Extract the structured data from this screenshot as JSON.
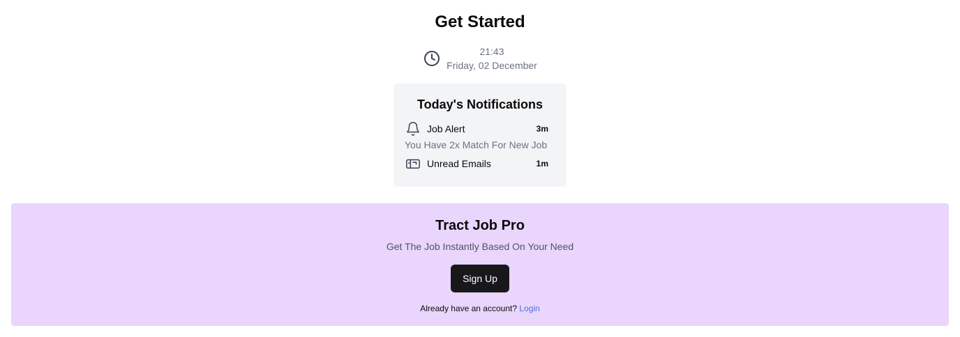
{
  "page": {
    "title": "Get Started"
  },
  "clock": {
    "icon": "clock-icon",
    "time": "21:43",
    "date": "Friday, 02 December"
  },
  "notifications": {
    "title": "Today's Notifications",
    "items": [
      {
        "icon": "bell-icon",
        "label": "Job Alert",
        "time": "3m",
        "description": "You Have 2x Match For New Job"
      },
      {
        "icon": "mailbox-icon",
        "label": "Unread Emails",
        "time": "1m"
      }
    ]
  },
  "pro": {
    "title": "Tract Job Pro",
    "subtitle": "Get The Job Instantly Based On Your Need",
    "signup_label": "Sign Up",
    "account_prompt": "Already have an account?",
    "login_label": "Login",
    "background_color": "#ead5fd",
    "button_color": "#18181b",
    "link_color": "#4f6fd6"
  }
}
